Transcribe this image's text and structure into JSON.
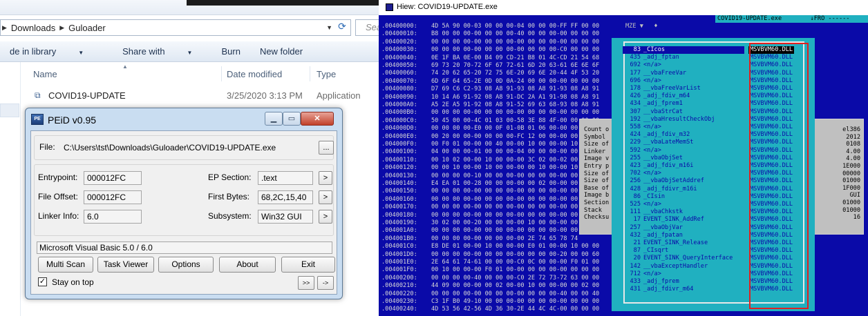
{
  "explorer": {
    "breadcrumb": [
      "Downloads",
      "Guloader"
    ],
    "search_placeholder": "Sea",
    "commands": [
      "de in library",
      "Share with",
      "Burn",
      "New folder"
    ],
    "columns": [
      "Name",
      "Date modified",
      "Type"
    ],
    "file": {
      "name": "COVID19-UPDATE",
      "date": "3/25/2020 3:13 PM",
      "type": "Application"
    }
  },
  "peid": {
    "title": "PEiD v0.95",
    "file_label": "File:",
    "file_path": "C:\\Users\\tst\\Downloads\\Guloader\\COVID19-UPDATE.exe",
    "browse_label": "...",
    "entrypoint_label": "Entrypoint:",
    "entrypoint": "000012FC",
    "file_offset_label": "File Offset:",
    "file_offset": "000012FC",
    "linker_label": "Linker Info:",
    "linker": "6.0",
    "ep_section_label": "EP Section:",
    "ep_section": ".text",
    "first_bytes_label": "First Bytes:",
    "first_bytes": "68,2C,15,40",
    "subsystem_label": "Subsystem:",
    "subsystem": "Win32 GUI",
    "detection": "Microsoft Visual Basic 5.0 / 6.0",
    "buttons": [
      "Multi Scan",
      "Task Viewer",
      "Options",
      "About",
      "Exit"
    ],
    "stay_on_top": "Stay on top",
    "stay_on_top_checked": true,
    "nav_buttons": [
      ">>",
      "->"
    ],
    "arrow": ">"
  },
  "hiew": {
    "window_title": "Hiew: COVID19-UPDATE.exe",
    "status_file": "COVID19-UPDATE.exe",
    "status_mode": "↓FRO ------",
    "hex_rows": [
      {
        "addr": ".00400000:",
        "bytes": "4D 5A 90 00-03 00 00 00-04 00 00 00-FF FF 00 00",
        "asc": "MZE ▼   ♦"
      },
      {
        "addr": ".00400010:",
        "bytes": "B8 00 00 00-00 00 00 00-40 00 00 00-00 00 00 00",
        "asc": ""
      },
      {
        "addr": ".00400020:",
        "bytes": "00 00 00 00-00 00 00 00-00 00 00 00-00 00 00 00",
        "asc": ""
      },
      {
        "addr": ".00400030:",
        "bytes": "00 00 00 00-00 00 00 00-00 00 00 00-C0 00 00 00",
        "asc": ""
      },
      {
        "addr": ".00400040:",
        "bytes": "0E 1F BA 0E-00 B4 09 CD-21 B8 01 4C-CD 21 54 68",
        "asc": ""
      },
      {
        "addr": ".00400050:",
        "bytes": "69 73 20 70-72 6F 67 72-61 6D 20 63-61 6E 6E 6F",
        "asc": ""
      },
      {
        "addr": ".00400060:",
        "bytes": "74 20 62 65-20 72 75 6E-20 69 6E 20-44 4F 53 20",
        "asc": ""
      },
      {
        "addr": ".00400070:",
        "bytes": "6D 6F 64 65-2E 0D 0D 0A-24 00 00 00-00 00 00 00",
        "asc": ""
      },
      {
        "addr": ".00400080:",
        "bytes": "D7 69 C6 C2-93 08 A8 91-93 08 A8 91-93 08 A8 91",
        "asc": ""
      },
      {
        "addr": ".00400090:",
        "bytes": "10 14 A6 91-92 08 A8 91-DC 2A A1 91-98 08 A8 91",
        "asc": ""
      },
      {
        "addr": ".004000A0:",
        "bytes": "A5 2E A5 91-92 08 A8 91-52 69 63 68-93 08 A8 91",
        "asc": ""
      },
      {
        "addr": ".004000B0:",
        "bytes": "00 00 00 00-00 00 00 00-00 00 00 00-00 00 00 00",
        "asc": ""
      },
      {
        "addr": ".004000C0:",
        "bytes": "50 45 00 00-4C 01 03 00-58 3E 88 4F-00 00 00 00",
        "asc": ""
      },
      {
        "addr": ".004000D0:",
        "bytes": "00 00 00 00-E0 00 0F 01-0B 01 06 00-00 00 00 00",
        "asc": ""
      },
      {
        "addr": ".004000E0:",
        "bytes": "00 20 00 00-00 00 00 00-FC 12 00 00-00 00 00 00",
        "asc": ""
      },
      {
        "addr": ".004000F0:",
        "bytes": "00 F0 01 00-00 00 40 00-00 10 00 00-00 10 00 00",
        "asc": ""
      },
      {
        "addr": ".00400100:",
        "bytes": "04 00 00 00-01 00 00 00-04 00 00 00-00 00 00 00",
        "asc": ""
      },
      {
        "addr": ".00400110:",
        "bytes": "00 10 02 00-00 10 00 00-00 3C 02 00-02 00 00 00",
        "asc": ""
      },
      {
        "addr": ".00400120:",
        "bytes": "00 00 10 00-00 10 00 00-00 00 10 00-00 10 00 00",
        "asc": ""
      },
      {
        "addr": ".00400130:",
        "bytes": "00 00 00 00-10 00 00 00-00 00 00 00-00 00 00 00",
        "asc": ""
      },
      {
        "addr": ".00400140:",
        "bytes": "E4 EA 01 00-28 00 00 00-00 00 02 00-00 00 00 00",
        "asc": ""
      },
      {
        "addr": ".00400150:",
        "bytes": "00 00 00 00-00 00 00 00-00 00 00 00-00 00 00 00",
        "asc": ""
      },
      {
        "addr": ".00400160:",
        "bytes": "00 00 00 00-00 00 00 00-00 00 00 00-00 00 00 00",
        "asc": ""
      },
      {
        "addr": ".00400170:",
        "bytes": "00 00 00 00-00 00 00 00-00 00 00 00-00 00 00 00",
        "asc": ""
      },
      {
        "addr": ".00400180:",
        "bytes": "00 00 00 00-00 00 00 00-00 00 00 00-00 00 00 00",
        "asc": ""
      },
      {
        "addr": ".00400190:",
        "bytes": "30 02 00 00-20 00 00 00-00 10 00 00-00 00 00 00",
        "asc": ""
      },
      {
        "addr": ".004001A0:",
        "bytes": "00 00 00 00-00 00 00 00-00 00 00 00-00 00 00 00",
        "asc": ""
      },
      {
        "addr": ".004001B0:",
        "bytes": "00 00 00 00-00 00 00 00-00 2E 74 65 78 74",
        "asc": ""
      },
      {
        "addr": ".004001C0:",
        "bytes": "E8 DE 01 00-00 10 00 00-00 E0 01 00-00 10 00 00",
        "asc": ""
      },
      {
        "addr": ".004001D0:",
        "bytes": "00 00 00 00-00 00 00 00-00 00 00 00-20 00 00 60",
        "asc": ""
      },
      {
        "addr": ".004001E0:",
        "bytes": "2E 64 61 74-61 00 00 00-C0 0C 00 00-00 F0 01 00",
        "asc": ""
      },
      {
        "addr": ".004001F0:",
        "bytes": "00 10 00 00-00 F0 01 00-00 00 00 00-00 00 00 00",
        "asc": ""
      },
      {
        "addr": ".00400200:",
        "bytes": "00 00 00 00-40 00 00 00-C0 2E 72 73-72 63 00 00",
        "asc": ""
      },
      {
        "addr": ".00400210:",
        "bytes": "44 09 00 00-00 00 02 00-00 10 00 00-00 00 02 00",
        "asc": ""
      },
      {
        "addr": ".00400220:",
        "bytes": "00 00 00 00-00 00 00 00-00 00 00 00-40 00 00 40",
        "asc": ""
      },
      {
        "addr": ".00400230:",
        "bytes": "C3 1F B0 49-10 00 00 00-00 00 00 00-00 00 00 00",
        "asc": ""
      },
      {
        "addr": ".00400240:",
        "bytes": "4D 53 56 42-56 4D 36 30-2E 44 4C 4C-00 00 00 00",
        "asc": ""
      }
    ],
    "header_panel": {
      "labels": [
        "Count o",
        "Symbol",
        "Size of",
        "Linker",
        "Image v",
        "Entry p",
        "Size of",
        "Size of",
        "Base of",
        "Image b",
        "Section",
        "Stack",
        "Checksu"
      ],
      "values": [
        "el386",
        "2012",
        "0108",
        "4.00",
        "4.00",
        "1E000",
        "00000",
        "01000",
        "1F000",
        "GUI",
        "01000",
        "01000",
        "16"
      ]
    },
    "imports": [
      {
        "num": "83",
        "name": "_CIcos",
        "dll": "MSVBVM60.DLL",
        "selected": true
      },
      {
        "num": "435",
        "name": "_adj_fptan",
        "dll": "MSVBVM60.DLL"
      },
      {
        "num": "692",
        "name": "<n/a>",
        "dll": "MSVBVM60.DLL"
      },
      {
        "num": "177",
        "name": "__vbaFreeVar",
        "dll": "MSVBVM60.DLL"
      },
      {
        "num": "696",
        "name": "<n/a>",
        "dll": "MSVBVM60.DLL"
      },
      {
        "num": "178",
        "name": "__vbaFreeVarList",
        "dll": "MSVBVM60.DLL"
      },
      {
        "num": "426",
        "name": "_adj_fdiv_m64",
        "dll": "MSVBVM60.DLL"
      },
      {
        "num": "434",
        "name": "_adj_fprem1",
        "dll": "MSVBVM60.DLL"
      },
      {
        "num": "307",
        "name": "__vbaStrCat",
        "dll": "MSVBVM60.DLL"
      },
      {
        "num": "192",
        "name": "__vbaHresultCheckObj",
        "dll": "MSVBVM60.DLL"
      },
      {
        "num": "558",
        "name": "<n/a>",
        "dll": "MSVBVM60.DLL"
      },
      {
        "num": "424",
        "name": "_adj_fdiv_m32",
        "dll": "MSVBVM60.DLL"
      },
      {
        "num": "229",
        "name": "__vbaLateMemSt",
        "dll": "MSVBVM60.DLL"
      },
      {
        "num": "592",
        "name": "<n/a>",
        "dll": "MSVBVM60.DLL"
      },
      {
        "num": "255",
        "name": "__vbaObjSet",
        "dll": "MSVBVM60.DLL"
      },
      {
        "num": "423",
        "name": "_adj_fdiv_m16i",
        "dll": "MSVBVM60.DLL"
      },
      {
        "num": "702",
        "name": "<n/a>",
        "dll": "MSVBVM60.DLL"
      },
      {
        "num": "256",
        "name": "__vbaObjSetAddref",
        "dll": "MSVBVM60.DLL"
      },
      {
        "num": "428",
        "name": "_adj_fdivr_m16i",
        "dll": "MSVBVM60.DLL"
      },
      {
        "num": "86",
        "name": "_CIsin",
        "dll": "MSVBVM60.DLL"
      },
      {
        "num": "525",
        "name": "<n/a>",
        "dll": "MSVBVM60.DLL"
      },
      {
        "num": "111",
        "name": "__vbaChkstk",
        "dll": "MSVBVM60.DLL"
      },
      {
        "num": "17",
        "name": "EVENT_SINK_AddRef",
        "dll": "MSVBVM60.DLL"
      },
      {
        "num": "257",
        "name": "__vbaObjVar",
        "dll": "MSVBVM60.DLL"
      },
      {
        "num": "432",
        "name": "_adj_fpatan",
        "dll": "MSVBVM60.DLL"
      },
      {
        "num": "21",
        "name": "EVENT_SINK_Release",
        "dll": "MSVBVM60.DLL"
      },
      {
        "num": "87",
        "name": "_CIsqrt",
        "dll": "MSVBVM60.DLL"
      },
      {
        "num": "20",
        "name": "EVENT_SINK_QueryInterface",
        "dll": "MSVBVM60.DLL"
      },
      {
        "num": "142",
        "name": "__vbaExceptHandler",
        "dll": "MSVBVM60.DLL"
      },
      {
        "num": "712",
        "name": "<n/a>",
        "dll": "MSVBVM60.DLL"
      },
      {
        "num": "433",
        "name": "_adj_fprem",
        "dll": "MSVBVM60.DLL"
      },
      {
        "num": "431",
        "name": "_adj_fdivr_m64",
        "dll": "MSVBVM60.DLL"
      }
    ]
  },
  "colors": {
    "hiew_bg": "#0a0aa8",
    "hiew_cyan": "#20b0c0",
    "highlight_red": "#e02020"
  }
}
